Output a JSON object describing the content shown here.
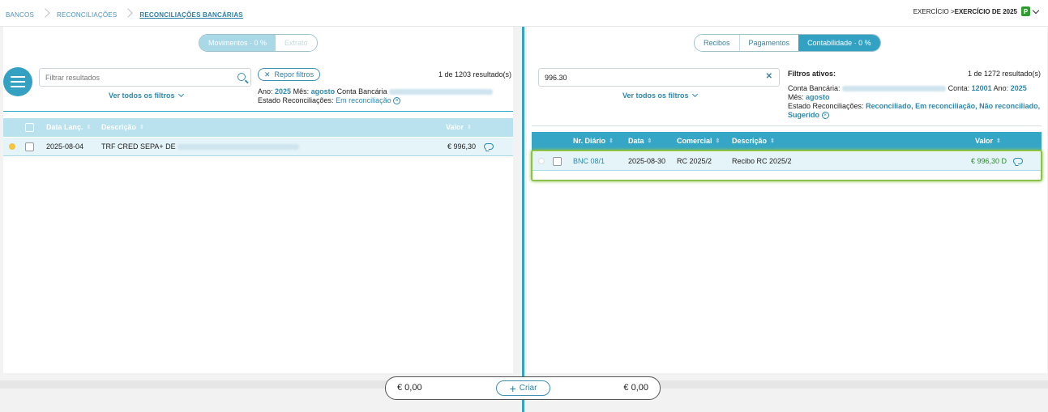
{
  "breadcrumb": [
    "Bancos",
    "Reconciliações",
    "Reconciliações Bancárias"
  ],
  "exercise": {
    "prefix": "EXERCÍCIO > ",
    "value": "EXERCÍCIO DE 2025",
    "badge": "P"
  },
  "left": {
    "tabs": [
      "Movimentos · 0 %",
      "Extrato"
    ],
    "search_placeholder": "Filtrar resultados",
    "see_filters": "Ver todos os filtros",
    "reset_filters": "Repor filtros",
    "results": "1 de 1203 resultado(s)",
    "filters": {
      "ano_label": "Ano:",
      "ano": "2025",
      "mes_label": "Mês:",
      "mes": "agosto",
      "conta_label": "Conta Bancária",
      "estado_label": "Estado Reconciliações:",
      "estado": "Em reconciliação"
    },
    "columns": [
      "Data Lanç.",
      "Descrição",
      "Valor"
    ],
    "rows": [
      {
        "date": "2025-08-04",
        "desc": "TRF CRED SEPA+ DE",
        "value": "€ 996,30",
        "status_color": "#f5c542"
      }
    ]
  },
  "right": {
    "tabs": [
      "Recibos",
      "Pagamentos",
      "Contabilidade · 0 %"
    ],
    "search_value": "996.30",
    "see_filters": "Ver todos os filtros",
    "active_filters_title": "Filtros ativos:",
    "results": "1 de 1272 resultado(s)",
    "filters": {
      "conta_label": "Conta Bancária:",
      "conta2_label": "Conta:",
      "conta2": "12001",
      "ano_label": "Ano:",
      "ano": "2025",
      "mes_label": "Mês:",
      "mes": "agosto",
      "estado_label": "Estado Reconciliações:",
      "estado": "Reconciliado, Em reconciliação, Não reconciliado,",
      "estado2": "Sugerido"
    },
    "columns": [
      "Nr. Diário",
      "Data",
      "Comercial",
      "Descrição",
      "Valor"
    ],
    "rows": [
      {
        "diario": "BNC 08/1",
        "date": "2025-08-30",
        "comercial": "RC 2025/2",
        "desc": "Recibo RC 2025/2",
        "value": "€ 996,30 D"
      }
    ]
  },
  "footer": {
    "left_amount": "€ 0,00",
    "create": "Criar",
    "right_amount": "€ 0,00"
  }
}
